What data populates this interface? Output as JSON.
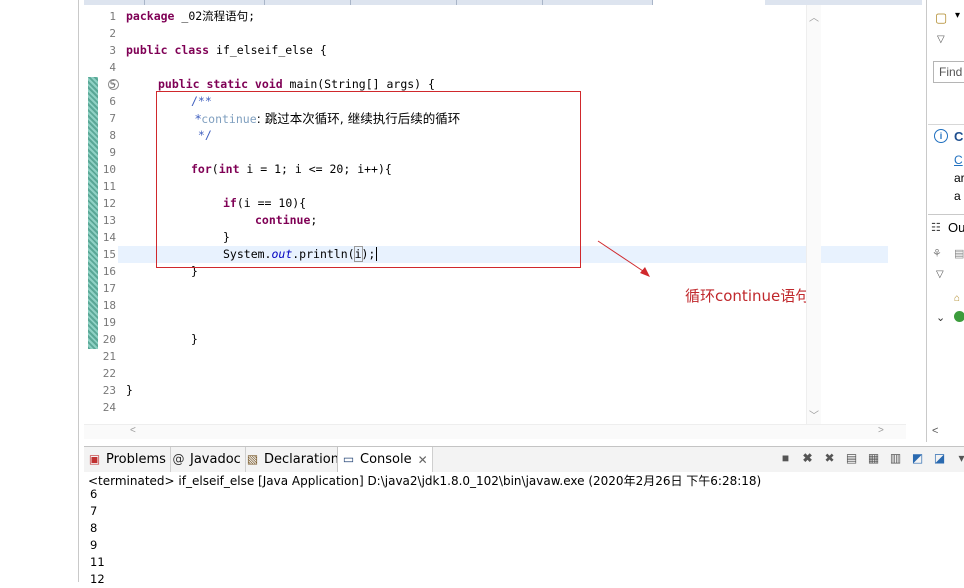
{
  "editor": {
    "line_numbers": [
      "1",
      "2",
      "3",
      "4",
      "5",
      "6",
      "7",
      "8",
      "9",
      "10",
      "11",
      "12",
      "13",
      "14",
      "15",
      "16",
      "17",
      "18",
      "19",
      "20",
      "21",
      "22",
      "23",
      "24"
    ],
    "code": {
      "l1_kw": "package",
      "l1_rest": " _02流程语句;",
      "l3_kw": "public class",
      "l3_rest": " if_elseif_else {",
      "l5_kw": "public static void",
      "l5_rest": " main(String[] args) {",
      "l6": "/**",
      "l7_prefix": " *",
      "l7_tag": "continue",
      "l7_rest": ": 跳过本次循环, 继续执行后续的循环",
      "l8": " */",
      "l10_kw": "for",
      "l10_int": "int",
      "l10_rest_a": "(",
      "l10_rest_b": " i = 1; i <= 20; i++){",
      "l12_kw": "if",
      "l12_rest": "(i == 10){",
      "l13_kw": "continue",
      "l13_rest": ";",
      "l14": "}",
      "l15_a": "System.",
      "l15_field": "out",
      "l15_b": ".println(",
      "l15_var": "i",
      "l15_c": ");",
      "l16": "}",
      "l20": "}",
      "l23": "}"
    }
  },
  "annotation": {
    "label": "循环continue语句",
    "color": "#c0282c"
  },
  "right_panel": {
    "find_placeholder": "Find",
    "info_letter": "C",
    "info_line1": "C",
    "info_line2": "ar",
    "info_line3": "a",
    "outline_title": "Ou"
  },
  "console": {
    "tabs": [
      {
        "label": "Problems",
        "icon": "problems-icon"
      },
      {
        "label": "Javadoc",
        "icon": "at-icon"
      },
      {
        "label": "Declaration",
        "icon": "declaration-icon"
      },
      {
        "label": "Console",
        "icon": "console-icon"
      }
    ],
    "status": "<terminated> if_elseif_else [Java Application] D:\\java2\\jdk1.8.0_102\\bin\\javaw.exe (2020年2月26日 下午6:28:18)",
    "output": [
      "6",
      "7",
      "8",
      "9",
      "11",
      "12"
    ]
  }
}
